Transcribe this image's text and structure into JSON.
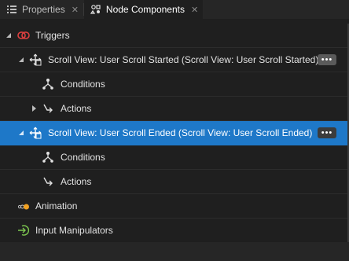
{
  "tabs": [
    {
      "label": "Properties",
      "icon": "list-icon",
      "close": "✕"
    },
    {
      "label": "Node Components",
      "icon": "node-components-icon",
      "close": "✕"
    }
  ],
  "tree": {
    "triggers": {
      "label": "Triggers",
      "icon": "trigger-icon",
      "accent": "#e04040"
    },
    "started": {
      "label": "Scroll View: User Scroll Started (Scroll View: User Scroll Started)",
      "more": "•••",
      "conditions": "Conditions",
      "actions": "Actions"
    },
    "ended": {
      "label": "Scroll View: User Scroll Ended (Scroll View: User Scroll Ended)",
      "more": "•••",
      "conditions": "Conditions",
      "actions": "Actions"
    },
    "animation": {
      "label": "Animation",
      "icon": "animation-icon",
      "accent": "#f0a020"
    },
    "input_manipulators": {
      "label": "Input Manipulators",
      "icon": "input-manipulator-icon",
      "accent": "#7ec850"
    }
  },
  "colors": {
    "selected": "#1e78c8",
    "background": "#1f1f1f"
  }
}
